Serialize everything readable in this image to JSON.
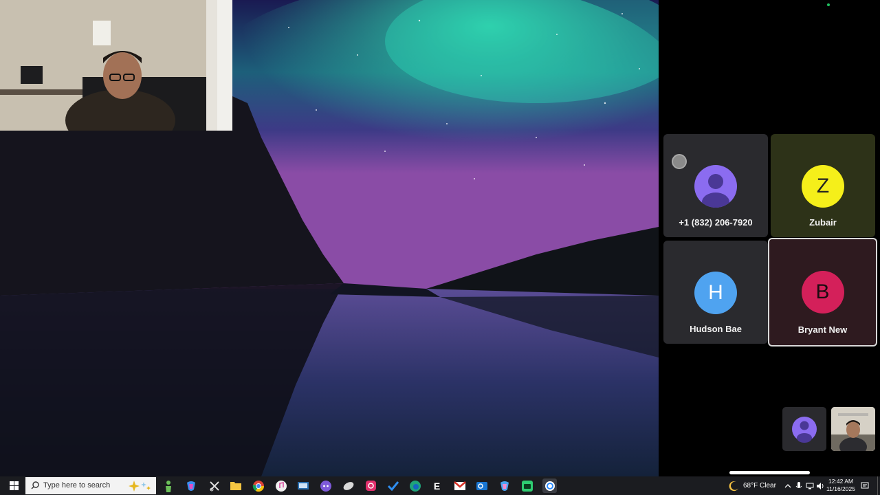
{
  "participants": [
    {
      "id": "phone",
      "initial": "",
      "name": "+1 (832) 206-7920",
      "avatar_color": "#8b6cf0"
    },
    {
      "id": "zubair",
      "initial": "Z",
      "name": "Zubair",
      "avatar_color": "#f5ef1a"
    },
    {
      "id": "hudson",
      "initial": "H",
      "name": "Hudson Bae",
      "avatar_color": "#4fa3f0"
    },
    {
      "id": "bryant",
      "initial": "B",
      "name": "Bryant New",
      "avatar_color": "#d4205a"
    }
  ],
  "taskbar": {
    "search_placeholder": "Type here to search",
    "weather": "68°F  Clear",
    "time": "12:42 AM",
    "date": "11/16/2025"
  },
  "icons": {
    "start": "windows-logo-icon",
    "search": "magnifier-icon",
    "pinned": [
      "figure-icon",
      "copilot-icon",
      "snipping-icon",
      "file-explorer-icon",
      "chrome-icon",
      "itunes-icon",
      "network-app-icon",
      "discord-icon",
      "app-icon",
      "instagram-icon",
      "checkmark-icon",
      "edge-icon",
      "e-icon",
      "gmail-icon",
      "outlook-icon",
      "copilot-pro-icon",
      "android-icon",
      "zoom-icon"
    ]
  },
  "colors": {
    "taskbar": "#1b1c20",
    "highlight_border": "#d9d9d9"
  }
}
